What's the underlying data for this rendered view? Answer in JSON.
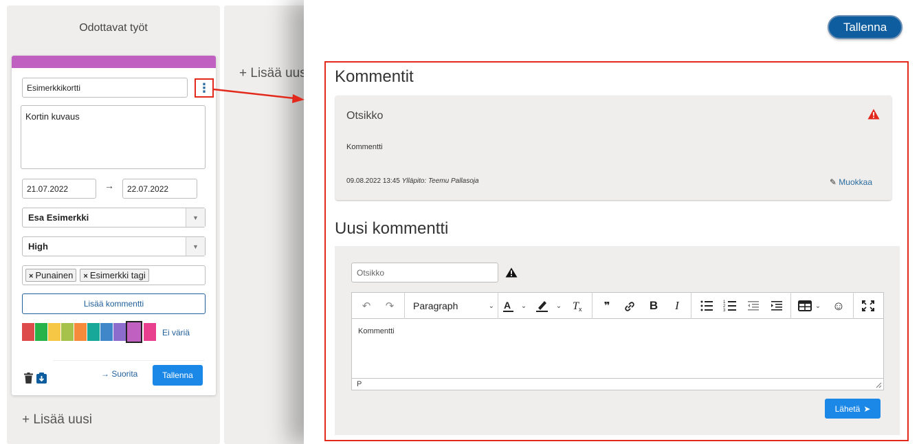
{
  "board": {
    "column1_title": "Odottavat työt",
    "add_new": "+ Lisää uusi",
    "column2_add_new": "+ Lisää uus"
  },
  "card": {
    "title_value": "Esimerkkikortti",
    "menu_glyph": "⋮",
    "description_value": "Kortin kuvaus",
    "start_date": "21.07.2022",
    "date_arrow": "→",
    "end_date": "22.07.2022",
    "assignee": "Esa Esimerkki",
    "priority": "High",
    "select_caret": "▼",
    "tags": [
      "Punainen",
      "Esimerkki tagi"
    ],
    "tag_remove_glyph": "×",
    "add_comment_label": "Lisää kommentti",
    "colors": [
      "#dd4b4b",
      "#27b24a",
      "#f6c744",
      "#a7c24a",
      "#f58a3a",
      "#17a89a",
      "#3f87c9",
      "#8c6ccc",
      "#c060c0",
      "#e8408f"
    ],
    "selected_color_index": 8,
    "no_color_label": "Ei väriä",
    "complete_label": "→ Suorita",
    "save_label": "Tallenna",
    "bar_color": "#c060c0",
    "icons": [
      "trash-icon",
      "save-to-icon"
    ]
  },
  "drawer": {
    "save_label": "Tallenna",
    "comments_heading": "Kommentit",
    "comment": {
      "title": "Otsikko",
      "body": "Kommentti",
      "timestamp": "09.08.2022 13:45",
      "author": "Ylläpito: Teemu Pallasoja",
      "edit_label": "Muokkaa",
      "edit_glyph": "✎"
    },
    "new_comment_heading": "Uusi kommentti",
    "new_comment": {
      "title_placeholder": "Otsikko",
      "editor": {
        "undo": "↶",
        "redo": "↷",
        "format_label": "Paragraph",
        "caret": "⌄",
        "quote": "❞",
        "link": "⚭",
        "bold": "B",
        "italic": "I",
        "bullet_list": "☰",
        "numbered_list": "⒈",
        "outdent": "⇤",
        "indent": "⇥",
        "table": "▦",
        "emoji": "☺",
        "fullscreen": "⛶",
        "body_text": "Kommentti",
        "status_path": "P"
      },
      "send_label": "Lähetä",
      "send_glyph": "➤"
    },
    "warning_color": "#e3281c",
    "accent_color": "#1b87e6"
  }
}
